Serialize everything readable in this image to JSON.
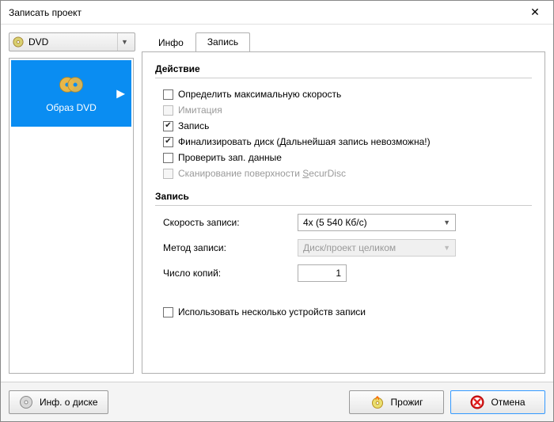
{
  "window": {
    "title": "Записать проект"
  },
  "drive_selector": {
    "value": "DVD"
  },
  "tabs": {
    "info": "Инфо",
    "write": "Запись",
    "active": "write"
  },
  "sidebar": {
    "card_label": "Образ DVD"
  },
  "sections": {
    "action": "Действие",
    "write": "Запись"
  },
  "checks": {
    "max_speed": {
      "label": "Определить максимальную скорость",
      "checked": false,
      "enabled": true
    },
    "simulate": {
      "label": "Имитация",
      "checked": false,
      "enabled": false
    },
    "write": {
      "label": "Запись",
      "checked": true,
      "enabled": true
    },
    "finalize": {
      "label": "Финализировать диск (Дальнейшая запись невозможна!)",
      "checked": true,
      "enabled": true
    },
    "verify": {
      "label": "Проверить зап. данные",
      "checked": false,
      "enabled": true
    },
    "surface_scan": {
      "label_pre": "Сканирование поверхности ",
      "label_u": "S",
      "label_post": "ecurDisc",
      "checked": false,
      "enabled": false
    },
    "multi_recorder": {
      "label": "Использовать несколько устройств записи",
      "checked": false,
      "enabled": true
    }
  },
  "form": {
    "speed_label": "Скорость записи:",
    "speed_value": "4x (5 540 Кб/с)",
    "method_label": "Метод записи:",
    "method_value": "Диск/проект целиком",
    "copies_label": "Число копий:",
    "copies_value": "1"
  },
  "footer": {
    "disc_info": "Инф. о диске",
    "burn": "Прожиг",
    "cancel": "Отмена"
  }
}
